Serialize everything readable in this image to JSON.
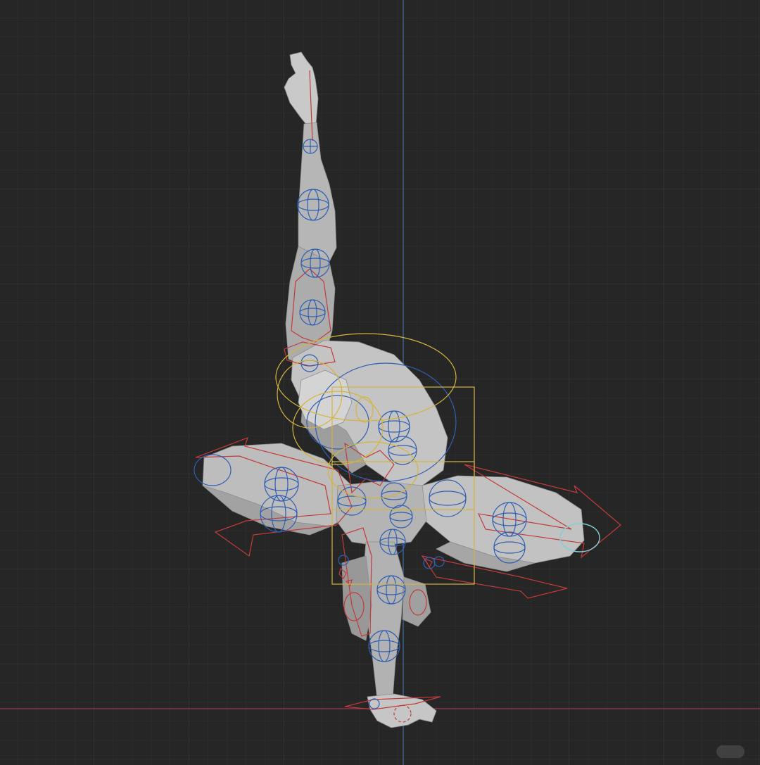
{
  "viewport": {
    "view": "3d-viewport",
    "shading": "solid",
    "grid": true,
    "colors": {
      "background": "#262626",
      "grid_minor": "#303030",
      "grid_major": "#3a3a3a",
      "axis_z": "#3d6fa3",
      "axis_x": "#9a3a58",
      "mesh": "#b8b8b8",
      "rig_fk": "#c23b3b",
      "rig_ik": "#2f5fb3",
      "rig_root": "#d4b43a",
      "rig_selected": "#7fd0d6"
    }
  },
  "watermark": {
    "icon": "app-logo-icon",
    "text": ""
  }
}
